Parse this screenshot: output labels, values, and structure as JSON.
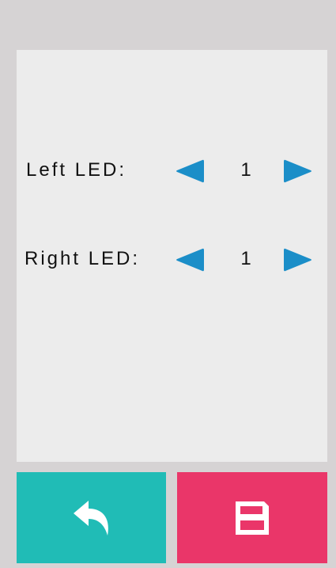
{
  "settings": {
    "rows": [
      {
        "label": "Left LED:",
        "value": "1"
      },
      {
        "label": "Right LED:",
        "value": "1"
      }
    ]
  },
  "icons": {
    "prev": "left-arrow-icon",
    "next": "right-arrow-icon",
    "back": "back-icon",
    "save": "floppy-disk-icon"
  },
  "colors": {
    "background": "#d6d3d4",
    "panel": "#ececec",
    "arrow": "#1b8ec8",
    "back_button": "#20bcb6",
    "save_button": "#ea3669"
  }
}
